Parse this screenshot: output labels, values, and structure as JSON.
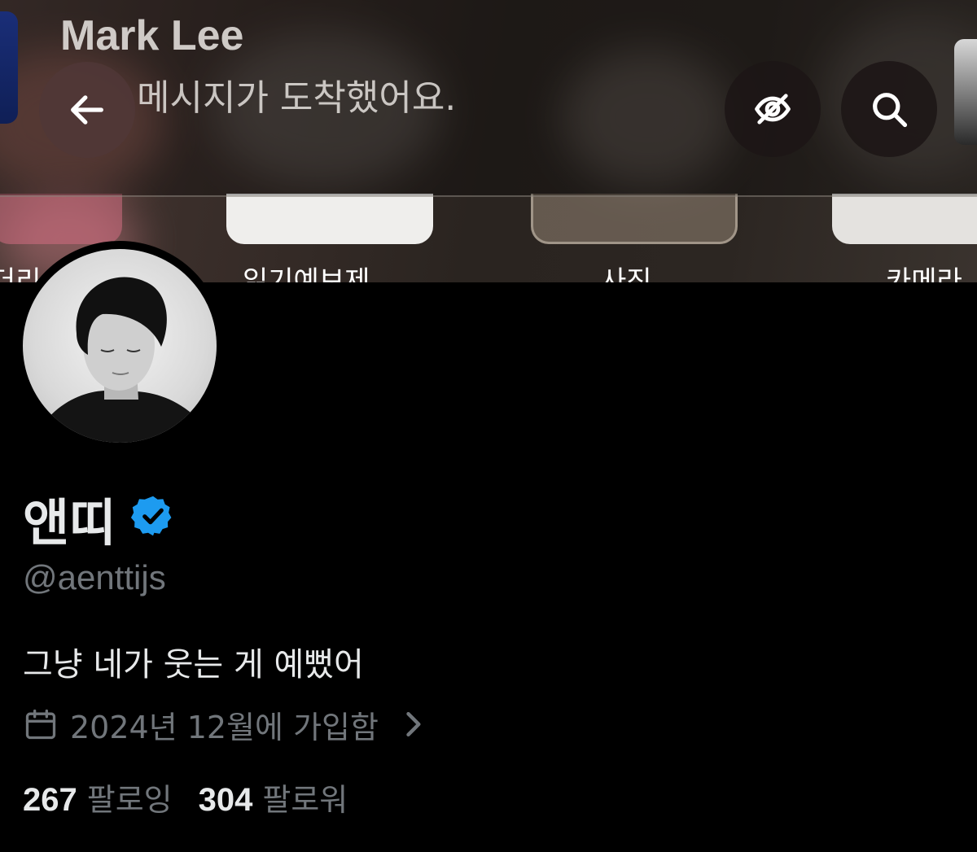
{
  "notification": {
    "title": "Mark Lee",
    "body": "메시지가 도착했어요."
  },
  "banner_tiles": {
    "labels": [
      "더리",
      "읽기예보제",
      "사진",
      "카메라"
    ]
  },
  "icons": {
    "back": "arrow-left-icon",
    "hide": "eye-slash-icon",
    "search": "search-icon",
    "verified": "verified-badge-icon",
    "calendar": "calendar-icon",
    "chevron": "chevron-right-icon"
  },
  "colors": {
    "background": "#000000",
    "text_primary": "#e7e9ea",
    "text_secondary": "#71767b",
    "verified_blue": "#1d9bf0"
  },
  "profile": {
    "display_name": "앤띠",
    "handle": "@aenttijs",
    "bio": "그냥 네가 웃는 게 예뻤어",
    "joined": "2024년 12월에 가입함",
    "following_count": "267",
    "following_label": "팔로잉",
    "followers_count": "304",
    "followers_label": "팔로워"
  }
}
